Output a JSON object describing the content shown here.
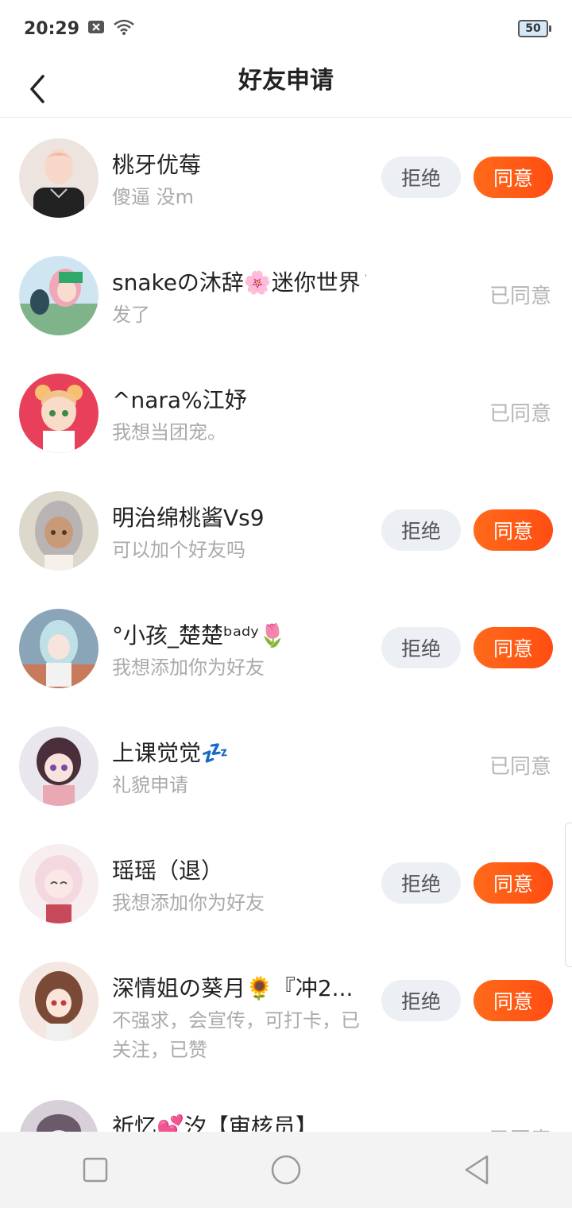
{
  "status": {
    "time": "20:29",
    "battery": "50"
  },
  "header": {
    "title": "好友申请"
  },
  "requests": [
    {
      "name": "桃牙优莓",
      "message": "傻逼  没m",
      "state": "pending",
      "reject_label": "拒绝",
      "accept_label": "同意"
    },
    {
      "name": "snakeの沐辞🌸迷你世界🌹",
      "message": "发了",
      "state": "accepted",
      "accepted_label": "已同意"
    },
    {
      "name": "^nara%江妤",
      "message": "我想当团宠。",
      "state": "accepted",
      "accepted_label": "已同意"
    },
    {
      "name": "明治绵桃酱Vs9",
      "message": "可以加个好友吗",
      "state": "pending",
      "reject_label": "拒绝",
      "accept_label": "同意"
    },
    {
      "name": "°小孩_楚楚ᵇᵃᵈʸ🌷",
      "message": "我想添加你为好友",
      "state": "pending",
      "reject_label": "拒绝",
      "accept_label": "同意"
    },
    {
      "name": "上课觉觉💤",
      "message": "礼貌申请",
      "state": "accepted",
      "accepted_label": "已同意"
    },
    {
      "name": "瑶瑶（退）",
      "message": "我想添加你为好友",
      "state": "pending",
      "reject_label": "拒绝",
      "accept_label": "同意"
    },
    {
      "name": "深情姐の葵月🌻『冲2...",
      "message": "不强求，会宣传，可打卡，已关注，已赞",
      "state": "pending",
      "reject_label": "拒绝",
      "accept_label": "同意"
    },
    {
      "name": "祈忆💕汐【审核员】",
      "message": "",
      "state": "accepted",
      "accepted_label": "已同意"
    }
  ],
  "colors": {
    "accent": "#ff5a14",
    "reject_bg": "#eceff4",
    "muted": "#aaaaaa"
  }
}
